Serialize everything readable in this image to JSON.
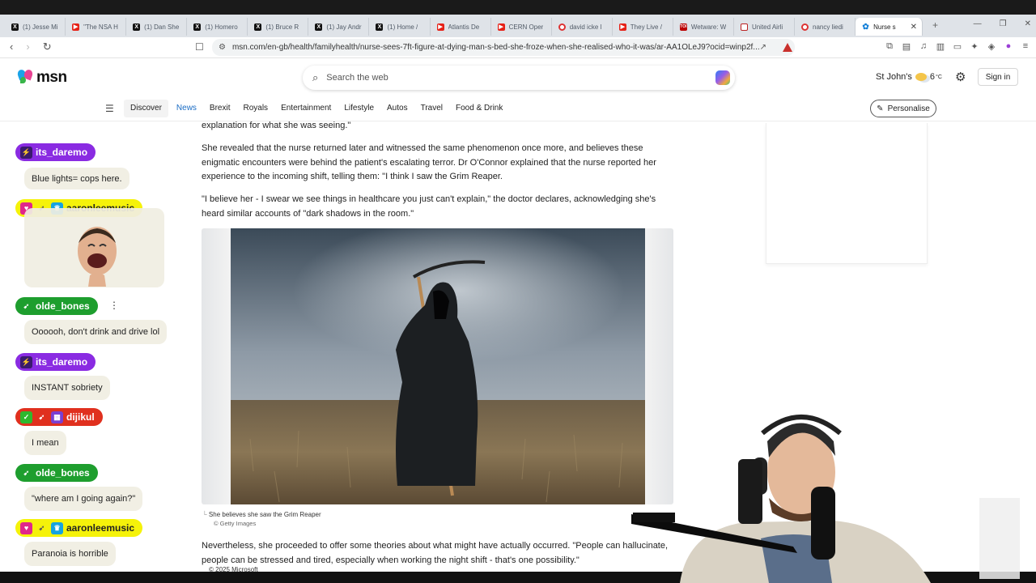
{
  "browser": {
    "tabs": [
      {
        "title": "(1) Jesse Mi",
        "favicon": "x-logo"
      },
      {
        "title": "\"The NSA H",
        "favicon": "youtube"
      },
      {
        "title": "(1) Dan She",
        "favicon": "x-logo"
      },
      {
        "title": "(1) Homero",
        "favicon": "x-logo"
      },
      {
        "title": "(1) Bruce R",
        "favicon": "x-logo"
      },
      {
        "title": "(1) Jay Andr",
        "favicon": "x-logo"
      },
      {
        "title": "(1) Home /",
        "favicon": "x-logo"
      },
      {
        "title": "Atlantis De",
        "favicon": "youtube"
      },
      {
        "title": "CERN Oper",
        "favicon": "youtube"
      },
      {
        "title": "david icke l",
        "favicon": "red-circle"
      },
      {
        "title": "They Live /",
        "favicon": "youtube"
      },
      {
        "title": "Wetware: W",
        "favicon": "bbc"
      },
      {
        "title": "United Airli",
        "favicon": "united"
      },
      {
        "title": "nancy liedi",
        "favicon": "red-circle"
      },
      {
        "title": "Nurse s",
        "favicon": "msn",
        "active": true
      }
    ],
    "url": "msn.com/en-gb/health/familyhealth/nurse-sees-7ft-figure-at-dying-man-s-bed-she-froze-when-she-realised-who-it-was/ar-AA1OLeJ9?ocid=winp2f...",
    "new_tab": "+",
    "icons": {
      "back": "arrow-left-icon",
      "forward": "arrow-right-icon",
      "reload": "reload-icon",
      "bookmark": "bookmark-icon"
    }
  },
  "msn": {
    "logo": "msn",
    "search_placeholder": "Search the web",
    "location": "St John's",
    "temperature": "6",
    "temp_unit": "°C",
    "signin": "Sign in",
    "nav": [
      "Discover",
      "News",
      "Brexit",
      "Royals",
      "Entertainment",
      "Lifestyle",
      "Autos",
      "Travel",
      "Food & Drink"
    ],
    "personalise": "Personalise"
  },
  "article": {
    "p0": "explanation for what she was seeing.\"",
    "p1": "She revealed that the nurse returned later and witnessed the same phenomenon once more, and believes these enigmatic encounters were behind the patient's escalating terror. Dr O'Connor explained that the nurse reported her experience to the incoming shift, telling them: \"I think I saw the Grim Reaper.",
    "p2": "\"I believe her - I swear we see things in healthcare you just can't explain,\" the doctor declares, acknowledging she's heard similar accounts of \"dark shadows in the room.\"",
    "caption": "She believes she saw the Grim Reaper",
    "credit": "© Getty Images",
    "p3": "Nevertheless, she proceeded to offer some theories about what might have actually occurred. \"People can hallucinate, people can be stressed and tired, especially when working the night shift - that's one possibility.\"",
    "footer": "© 2025 Microsoft"
  },
  "chat": [
    {
      "user": "its_daremo",
      "color": "#8a2be2",
      "text": "Blue lights= cops here."
    },
    {
      "user": "aaronleemusic",
      "color": "#f5f20a",
      "text_color": "#222",
      "text": ""
    },
    {
      "user": "olde_bones",
      "color": "#1e9e2e",
      "text": "Oooooh, don't drink and drive lol"
    },
    {
      "user": "its_daremo",
      "color": "#8a2be2",
      "text": "INSTANT sobriety"
    },
    {
      "user": "dijikul",
      "color": "#e0301e",
      "text": "I mean"
    },
    {
      "user": "olde_bones",
      "color": "#1e9e2e",
      "text": "\"where am I going again?\""
    },
    {
      "user": "aaronleemusic",
      "color": "#f5f20a",
      "text_color": "#222",
      "text": "Paranoia is horrible"
    }
  ]
}
